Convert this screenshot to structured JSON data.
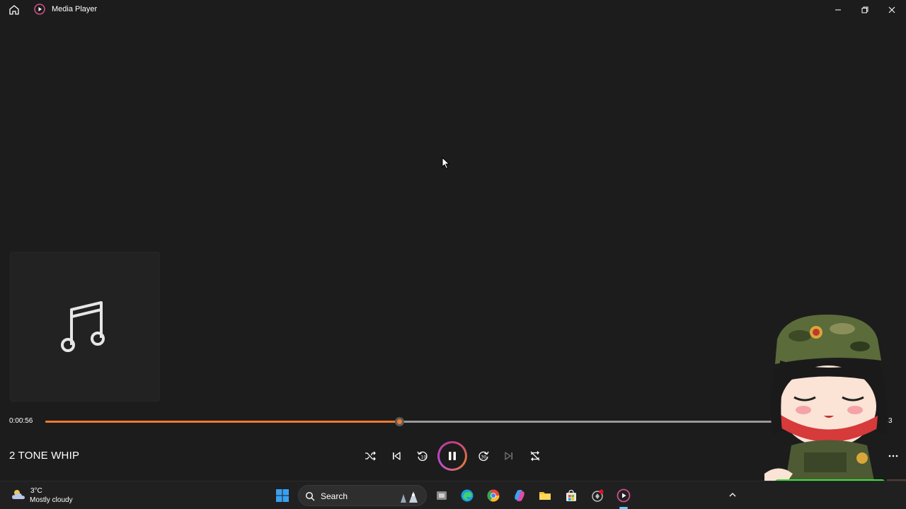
{
  "window": {
    "title": "Media Player"
  },
  "player": {
    "current_time": "0:00:56",
    "total_time_partial": "3",
    "progress": 0.4198,
    "track_title": "2 TONE WHIP",
    "state": "playing",
    "rewind_seconds": "10",
    "forward_seconds": "30"
  },
  "colors": {
    "accent": "#f07a2e",
    "background": "#1c1c1c",
    "taskbar": "#202020"
  },
  "taskbar": {
    "weather_temp": "3°C",
    "weather_desc": "Mostly cloudy",
    "search_label": "Search",
    "pinned": [
      "windows-start-icon",
      "search",
      "task-view-icon",
      "edge-icon",
      "chrome-icon",
      "copilot-icon",
      "file-explorer-icon",
      "store-icon",
      "app-icon",
      "media-player-icon"
    ]
  }
}
